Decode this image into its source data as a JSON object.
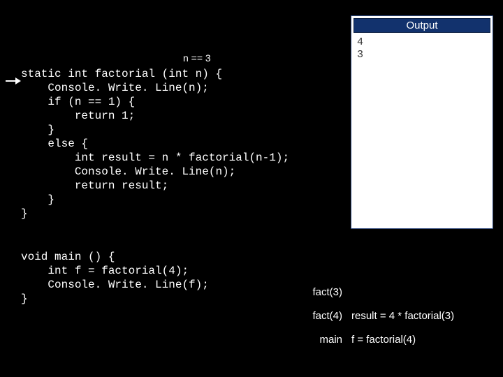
{
  "nvar": "n == 3",
  "code_block": "static int factorial (int n) {\n    Console. Write. Line(n);\n    if (n == 1) {\n        return 1;\n    }\n    else {\n        int result = n * factorial(n-1);\n        Console. Write. Line(n);\n        return result;\n    }\n}",
  "main_block": "void main () {\n    int f = factorial(4);\n    Console. Write. Line(f);\n}",
  "output": {
    "title": "Output",
    "lines": "4\n3"
  },
  "stack": {
    "rows": [
      {
        "label": "fact(3)",
        "value": ""
      },
      {
        "label": "fact(4)",
        "value": "result = 4 * factorial(3)"
      },
      {
        "label": "main",
        "value": "f = factorial(4)"
      }
    ]
  }
}
